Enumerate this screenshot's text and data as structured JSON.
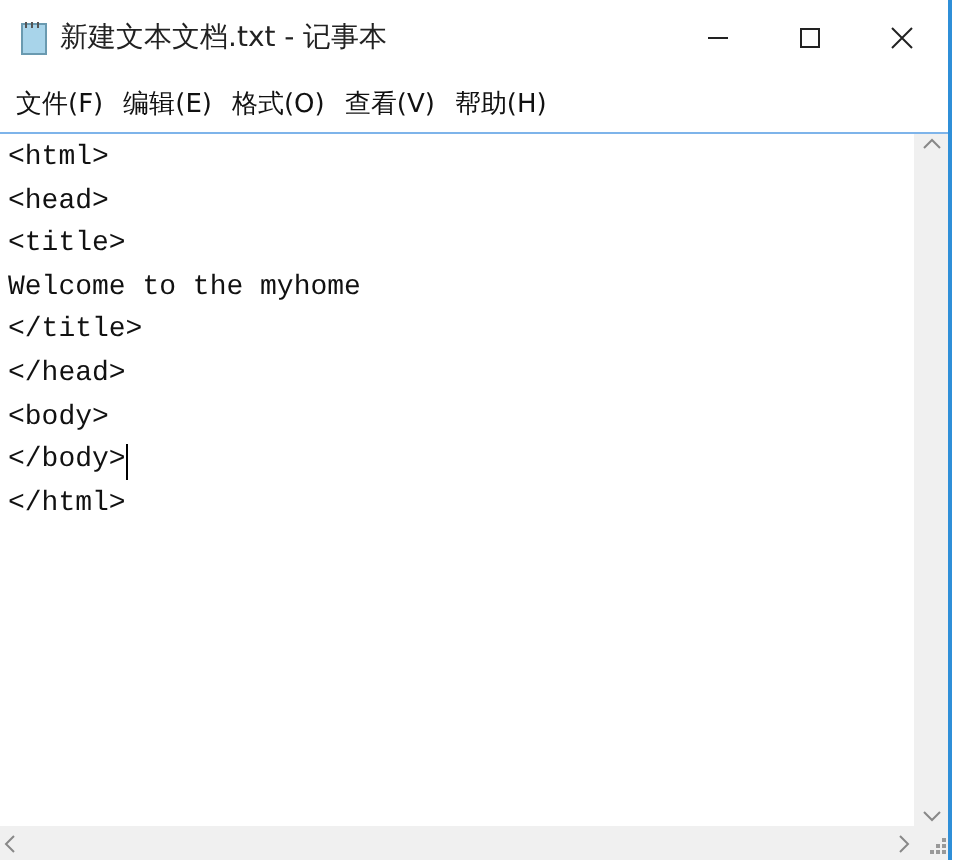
{
  "window": {
    "title": "新建文本文档.txt - 记事本"
  },
  "menu": [
    "文件(F)",
    "编辑(E)",
    "格式(O)",
    "查看(V)",
    "帮助(H)"
  ],
  "lines": [
    {
      "text": "<html>",
      "caret": false
    },
    {
      "text": "<head>",
      "caret": false
    },
    {
      "text": "<title>",
      "caret": false
    },
    {
      "text": "Welcome to the myhome",
      "caret": false
    },
    {
      "text": "</title>",
      "caret": false
    },
    {
      "text": "</head>",
      "caret": false
    },
    {
      "text": "<body>",
      "caret": false
    },
    {
      "text": "</body>",
      "caret": true
    },
    {
      "text": "</html>",
      "caret": false
    }
  ]
}
